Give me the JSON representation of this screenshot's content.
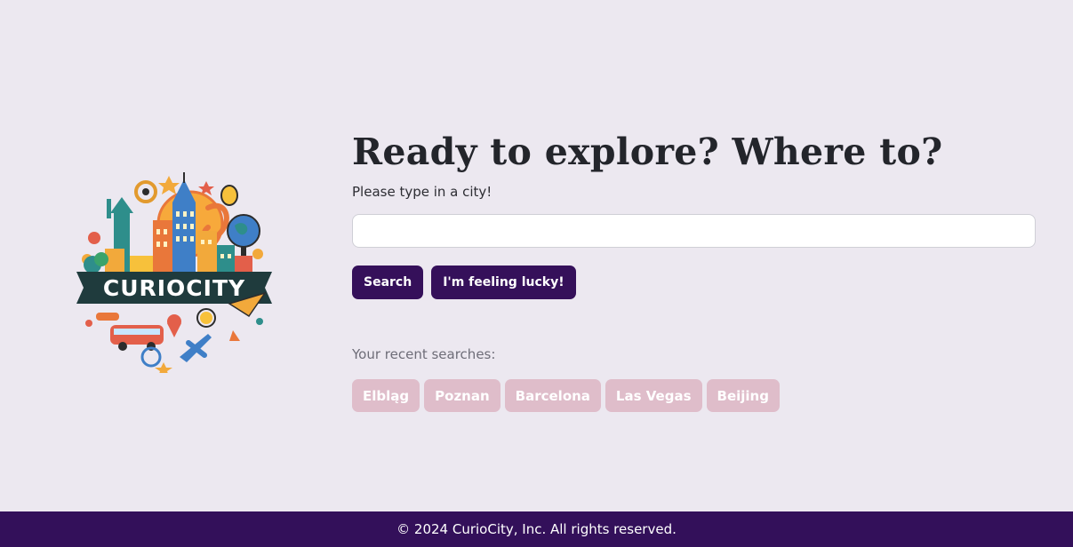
{
  "logo": {
    "text": "CURIOCITY",
    "colors": {
      "banner": "#1f3b3d",
      "sun": "#f7a93b",
      "building_blue": "#3f7fc7",
      "orange": "#e9773a",
      "teal": "#2e8e8b"
    }
  },
  "main": {
    "title": "Ready to explore? Where to?",
    "subtitle": "Please type in a city!",
    "city_input": {
      "value": "",
      "placeholder": ""
    },
    "search_button": "Search",
    "lucky_button": "I'm feeling lucky!"
  },
  "recent": {
    "label": "Your recent searches:",
    "items": [
      "Elbląg",
      "Poznan",
      "Barcelona",
      "Las Vegas",
      "Beijing"
    ]
  },
  "footer": {
    "text": "© 2024 CurioCity, Inc. All rights reserved."
  },
  "colors": {
    "page_background": "#ece8f0",
    "primary": "#35105a",
    "chip": "#dfbdca",
    "footer": "#33105a"
  }
}
